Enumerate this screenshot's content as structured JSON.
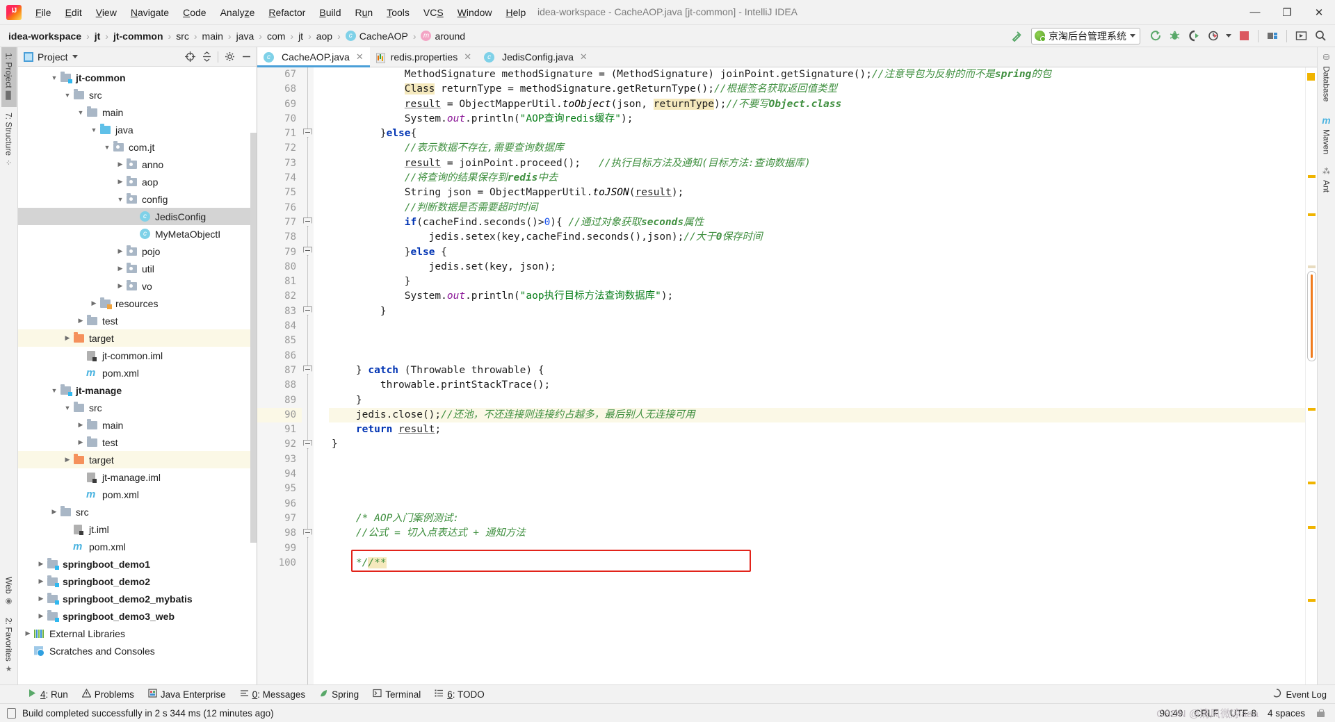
{
  "window": {
    "title": "idea-workspace - CacheAOP.java [jt-common] - IntelliJ IDEA",
    "minimize": "—",
    "maximize": "❐",
    "close": "✕"
  },
  "menubar": {
    "items": [
      "File",
      "Edit",
      "View",
      "Navigate",
      "Code",
      "Analyze",
      "Refactor",
      "Build",
      "Run",
      "Tools",
      "VCS",
      "Window",
      "Help"
    ]
  },
  "breadcrumbs": [
    {
      "label": "idea-workspace",
      "bold": true,
      "icon": ""
    },
    {
      "label": "jt",
      "bold": true,
      "icon": ""
    },
    {
      "label": "jt-common",
      "bold": true,
      "icon": ""
    },
    {
      "label": "src",
      "bold": false,
      "icon": ""
    },
    {
      "label": "main",
      "bold": false,
      "icon": ""
    },
    {
      "label": "java",
      "bold": false,
      "icon": ""
    },
    {
      "label": "com",
      "bold": false,
      "icon": ""
    },
    {
      "label": "jt",
      "bold": false,
      "icon": ""
    },
    {
      "label": "aop",
      "bold": false,
      "icon": ""
    },
    {
      "label": "CacheAOP",
      "bold": false,
      "icon": "class-icon"
    },
    {
      "label": "around",
      "bold": false,
      "icon": "method-icon"
    }
  ],
  "toolbar": {
    "run_config": "京淘后台管理系统",
    "icons": [
      "hammer-build-icon",
      "run-icon",
      "debug-icon",
      "run-with-coverage-icon",
      "profile-icon",
      "stop-icon",
      "project-structure-icon",
      "update-icon",
      "search-everywhere-icon"
    ]
  },
  "left_rail": {
    "project": "1: Project",
    "structure": "7: Structure",
    "favorites": "2: Favorites",
    "web": "Web"
  },
  "right_rail": {
    "database": "Database",
    "maven": "Maven",
    "ant": "Ant"
  },
  "project_panel": {
    "title": "Project",
    "tree": [
      {
        "indent": 2,
        "twist": "▼",
        "icon": "module-folder",
        "label": "jt-common",
        "bold": true,
        "state": "normal"
      },
      {
        "indent": 3,
        "twist": "▼",
        "icon": "folder",
        "label": "src",
        "bold": false,
        "state": "normal"
      },
      {
        "indent": 4,
        "twist": "▼",
        "icon": "folder",
        "label": "main",
        "bold": false,
        "state": "normal"
      },
      {
        "indent": 5,
        "twist": "▼",
        "icon": "folder-blue",
        "label": "java",
        "bold": false,
        "state": "normal"
      },
      {
        "indent": 6,
        "twist": "▼",
        "icon": "package",
        "label": "com.jt",
        "bold": false,
        "state": "normal"
      },
      {
        "indent": 7,
        "twist": "▶",
        "icon": "package",
        "label": "anno",
        "bold": false,
        "state": "normal"
      },
      {
        "indent": 7,
        "twist": "▶",
        "icon": "package",
        "label": "aop",
        "bold": false,
        "state": "normal"
      },
      {
        "indent": 7,
        "twist": "▼",
        "icon": "package",
        "label": "config",
        "bold": false,
        "state": "normal"
      },
      {
        "indent": 8,
        "twist": "",
        "icon": "class",
        "label": "JedisConfig",
        "bold": false,
        "state": "selected"
      },
      {
        "indent": 8,
        "twist": "",
        "icon": "class",
        "label": "MyMetaObjectI",
        "bold": false,
        "state": "normal"
      },
      {
        "indent": 7,
        "twist": "▶",
        "icon": "package",
        "label": "pojo",
        "bold": false,
        "state": "normal"
      },
      {
        "indent": 7,
        "twist": "▶",
        "icon": "package",
        "label": "util",
        "bold": false,
        "state": "normal"
      },
      {
        "indent": 7,
        "twist": "▶",
        "icon": "package",
        "label": "vo",
        "bold": false,
        "state": "normal"
      },
      {
        "indent": 5,
        "twist": "▶",
        "icon": "folder-res",
        "label": "resources",
        "bold": false,
        "state": "normal"
      },
      {
        "indent": 4,
        "twist": "▶",
        "icon": "folder",
        "label": "test",
        "bold": false,
        "state": "normal"
      },
      {
        "indent": 3,
        "twist": "▶",
        "icon": "folder-orange",
        "label": "target",
        "bold": false,
        "state": "target"
      },
      {
        "indent": 4,
        "twist": "",
        "icon": "iml",
        "label": "jt-common.iml",
        "bold": false,
        "state": "normal"
      },
      {
        "indent": 4,
        "twist": "",
        "icon": "maven",
        "label": "pom.xml",
        "bold": false,
        "state": "normal"
      },
      {
        "indent": 2,
        "twist": "▼",
        "icon": "module-folder",
        "label": "jt-manage",
        "bold": true,
        "state": "normal"
      },
      {
        "indent": 3,
        "twist": "▼",
        "icon": "folder",
        "label": "src",
        "bold": false,
        "state": "normal"
      },
      {
        "indent": 4,
        "twist": "▶",
        "icon": "folder",
        "label": "main",
        "bold": false,
        "state": "normal"
      },
      {
        "indent": 4,
        "twist": "▶",
        "icon": "folder",
        "label": "test",
        "bold": false,
        "state": "normal"
      },
      {
        "indent": 3,
        "twist": "▶",
        "icon": "folder-orange",
        "label": "target",
        "bold": false,
        "state": "target"
      },
      {
        "indent": 4,
        "twist": "",
        "icon": "iml",
        "label": "jt-manage.iml",
        "bold": false,
        "state": "normal"
      },
      {
        "indent": 4,
        "twist": "",
        "icon": "maven",
        "label": "pom.xml",
        "bold": false,
        "state": "normal"
      },
      {
        "indent": 2,
        "twist": "▶",
        "icon": "folder",
        "label": "src",
        "bold": false,
        "state": "normal"
      },
      {
        "indent": 3,
        "twist": "",
        "icon": "iml",
        "label": "jt.iml",
        "bold": false,
        "state": "normal"
      },
      {
        "indent": 3,
        "twist": "",
        "icon": "maven",
        "label": "pom.xml",
        "bold": false,
        "state": "normal"
      },
      {
        "indent": 1,
        "twist": "▶",
        "icon": "module-folder",
        "label": "springboot_demo1",
        "bold": true,
        "state": "normal"
      },
      {
        "indent": 1,
        "twist": "▶",
        "icon": "module-folder",
        "label": "springboot_demo2",
        "bold": true,
        "state": "normal"
      },
      {
        "indent": 1,
        "twist": "▶",
        "icon": "module-folder",
        "label": "springboot_demo2_mybatis",
        "bold": true,
        "state": "normal"
      },
      {
        "indent": 1,
        "twist": "▶",
        "icon": "module-folder",
        "label": "springboot_demo3_web",
        "bold": true,
        "state": "normal"
      },
      {
        "indent": 0,
        "twist": "▶",
        "icon": "libraries",
        "label": "External Libraries",
        "bold": false,
        "state": "normal"
      },
      {
        "indent": 0,
        "twist": "",
        "icon": "scratches",
        "label": "Scratches and Consoles",
        "bold": false,
        "state": "normal"
      }
    ]
  },
  "editor": {
    "tabs": [
      {
        "label": "CacheAOP.java",
        "icon": "class-icon",
        "active": true
      },
      {
        "label": "redis.properties",
        "icon": "properties-icon",
        "active": false
      },
      {
        "label": "JedisConfig.java",
        "icon": "class-icon",
        "active": false
      }
    ],
    "first_line": 67,
    "lines": [
      {
        "n": 67,
        "html": "            MethodSignature methodSignature = (MethodSignature) joinPoint.getSignature();<span class=\"cm\">//注意导包为反射的而不是<b>spring</b>的包</span>",
        "clipped": true
      },
      {
        "n": 68,
        "html": "            <span class=\"hlbg\">Class</span> returnType = methodSignature.getReturnType();<span class=\"cm\">//根据签名获取返回值类型</span>"
      },
      {
        "n": 69,
        "html": "            <span class=\"ul\">result</span> = ObjectMapperUtil.<span class=\"mit\">toObject</span>(json, <span class=\"hlbg\">returnType</span>);<span class=\"cm\">//不要写<b>Object.class</b></span>"
      },
      {
        "n": 70,
        "html": "            System.<span class=\"fld\">out</span>.println(<span class=\"str\">\"AOP查询redis缓存\"</span>);"
      },
      {
        "n": 71,
        "html": "        }<span class=\"kw\">else</span>{"
      },
      {
        "n": 72,
        "html": "            <span class=\"cm\">//表示数据不存在,需要查询数据库</span>"
      },
      {
        "n": 73,
        "html": "            <span class=\"ul\">result</span> = joinPoint.proceed();   <span class=\"cm\">//执行目标方法及通知(目标方法:查询数据库)</span>"
      },
      {
        "n": 74,
        "html": "            <span class=\"cm\">//将查询的结果保存到<b>redis</b>中去</span>"
      },
      {
        "n": 75,
        "html": "            String json = ObjectMapperUtil.<span class=\"mit\">toJSON</span>(<span class=\"ul\">result</span>);"
      },
      {
        "n": 76,
        "html": "            <span class=\"cm\">//判断数据是否需要超时时间</span>"
      },
      {
        "n": 77,
        "html": "            <span class=\"kw\">if</span>(cacheFind.seconds()&gt;<span class=\"num\">0</span>){ <span class=\"cm\">//通过对象获取<b>seconds</b>属性</span>"
      },
      {
        "n": 78,
        "html": "                jedis.setex(key,cacheFind.seconds(),json);<span class=\"cm\">//大于<b>0</b>保存时间</span>"
      },
      {
        "n": 79,
        "html": "            }<span class=\"kw\">else</span> {"
      },
      {
        "n": 80,
        "html": "                jedis.set(key, json);"
      },
      {
        "n": 81,
        "html": "            }"
      },
      {
        "n": 82,
        "html": "            System.<span class=\"fld\">out</span>.println(<span class=\"str\">\"aop执行目标方法查询数据库\"</span>);"
      },
      {
        "n": 83,
        "html": "        }"
      },
      {
        "n": 84,
        "html": ""
      },
      {
        "n": 85,
        "html": ""
      },
      {
        "n": 86,
        "html": ""
      },
      {
        "n": 87,
        "html": "    } <span class=\"kw\">catch</span> (Throwable throwable) {"
      },
      {
        "n": 88,
        "html": "        throwable.printStackTrace();"
      },
      {
        "n": 89,
        "html": "    }"
      },
      {
        "n": 90,
        "html": "    jedis.close();<span class=\"cm\">//还池，不还连接则连接约占越多，最后别人无连接可用</span>",
        "highlight": true
      },
      {
        "n": 91,
        "html": "    <span class=\"kw\">return</span> <span class=\"ul\">result</span>;"
      },
      {
        "n": 92,
        "html": "}"
      },
      {
        "n": 93,
        "html": ""
      },
      {
        "n": 94,
        "html": ""
      },
      {
        "n": 95,
        "html": ""
      },
      {
        "n": 96,
        "html": ""
      },
      {
        "n": 97,
        "html": "    <span class=\"cm\">/* AOP入门案例测试:</span>"
      },
      {
        "n": 98,
        "html": "    <span class=\"cm\">//公式 = 切入点表达式 + 通知方法</span>"
      },
      {
        "n": 99,
        "html": ""
      },
      {
        "n": 100,
        "html": "    <span class=\"cm\">*/</span><span class=\"hlbg cm\">/**</span>"
      }
    ]
  },
  "bottom_tool_window": {
    "items": [
      {
        "label": "4: Run",
        "icon": "run-icon",
        "underline": "4"
      },
      {
        "label": "Problems",
        "icon": "warning-icon",
        "underline": ""
      },
      {
        "label": "Java Enterprise",
        "icon": "java-ee-icon",
        "underline": ""
      },
      {
        "label": "0: Messages",
        "icon": "messages-icon",
        "underline": "0"
      },
      {
        "label": "Spring",
        "icon": "spring-leaf-icon",
        "underline": ""
      },
      {
        "label": "Terminal",
        "icon": "terminal-icon",
        "underline": ""
      },
      {
        "label": "6: TODO",
        "icon": "todo-list-icon",
        "underline": "6"
      }
    ],
    "event_log": "Event Log"
  },
  "statusbar": {
    "message": "Build completed successfully in 2 s 344 ms (12 minutes ago)",
    "caret": "90:49",
    "line_separator": "CRLF",
    "encoding": "UTF-8",
    "indent": "4 spaces",
    "watermark": "CSDN @清风微凉aaa"
  }
}
